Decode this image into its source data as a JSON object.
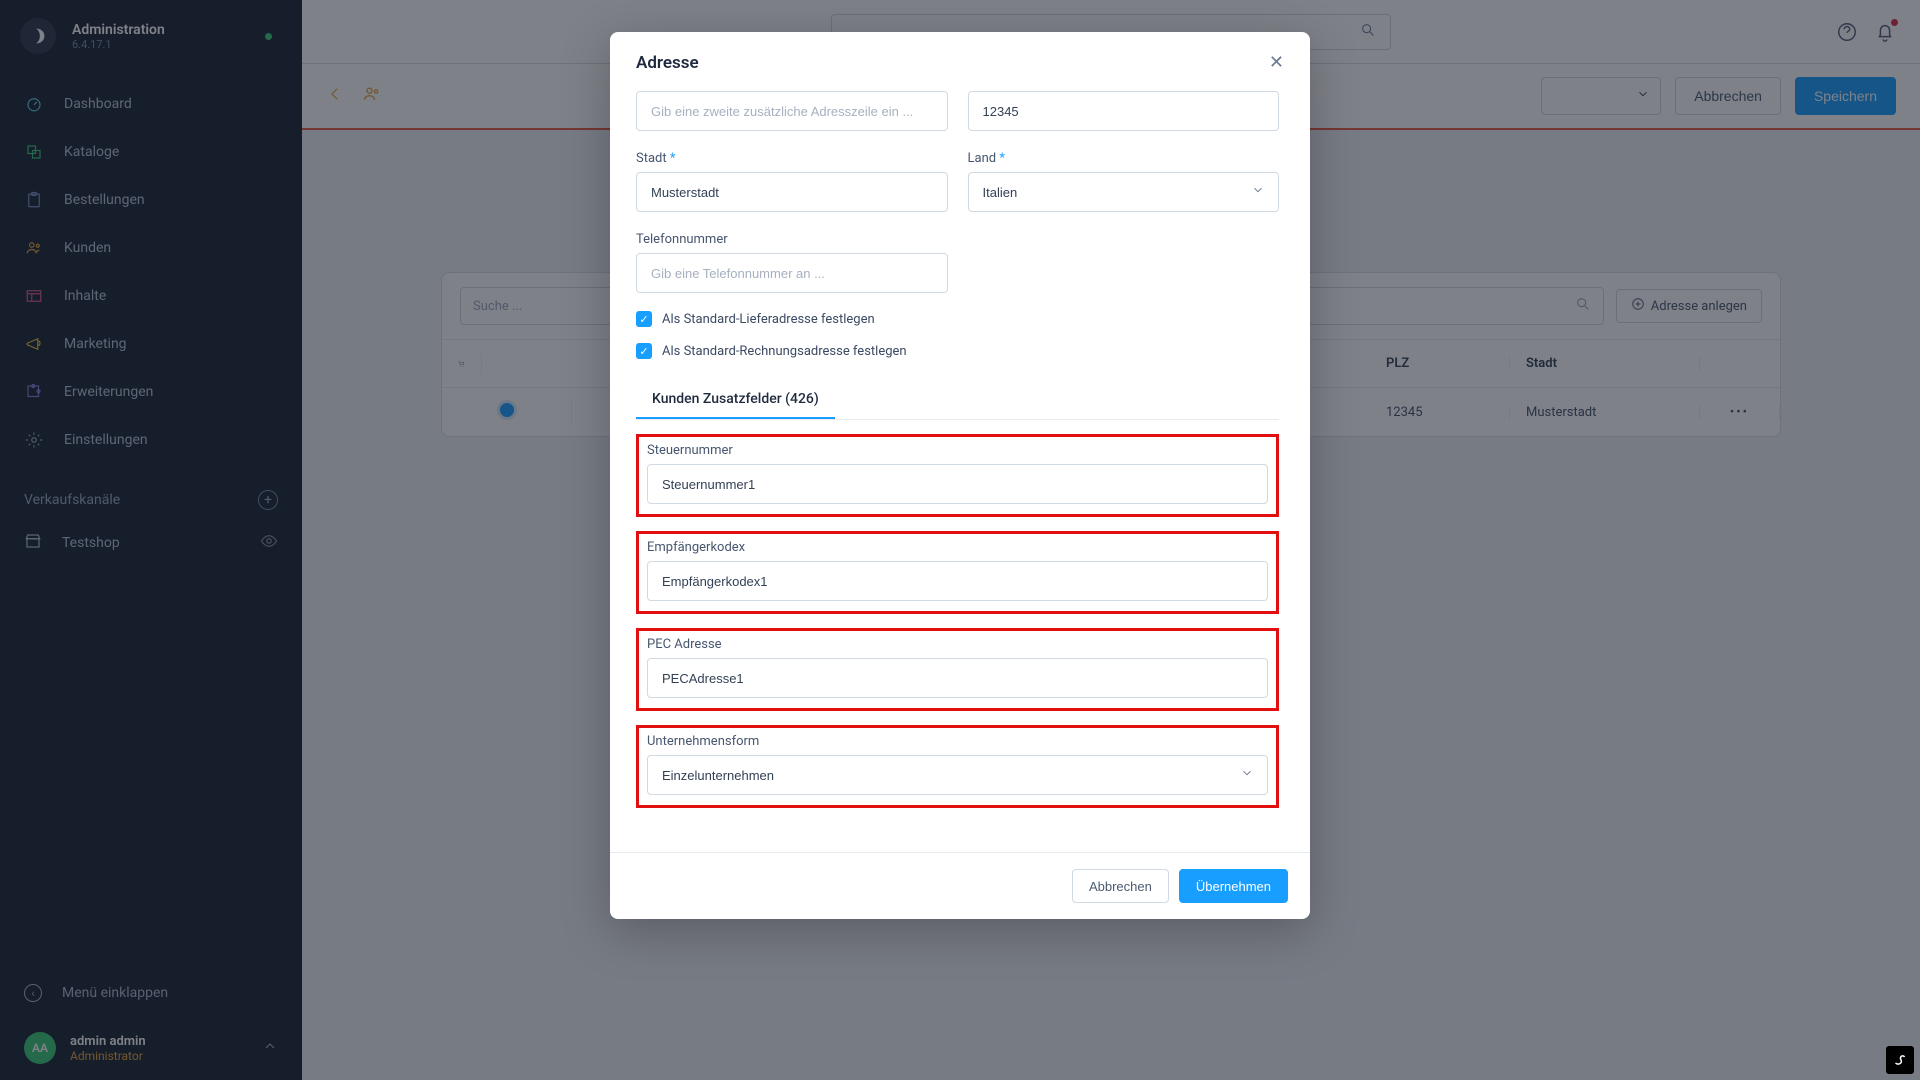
{
  "header": {
    "title": "Administration",
    "version": "6.4.17.1"
  },
  "sidebar": {
    "items": [
      {
        "label": "Dashboard"
      },
      {
        "label": "Kataloge"
      },
      {
        "label": "Bestellungen"
      },
      {
        "label": "Kunden"
      },
      {
        "label": "Inhalte"
      },
      {
        "label": "Marketing"
      },
      {
        "label": "Erweiterungen"
      },
      {
        "label": "Einstellungen"
      }
    ],
    "section_label": "Verkaufskanäle",
    "testshop": "Testshop",
    "collapse": "Menü einklappen",
    "user": {
      "initials": "AA",
      "name": "admin admin",
      "role": "Administrator"
    }
  },
  "pagebar": {
    "cancel": "Abbrechen",
    "save": "Speichern"
  },
  "card": {
    "search_placeholder": "Suche ...",
    "add_button": "Adresse anlegen",
    "columns": {
      "plz": "PLZ",
      "stadt": "Stadt"
    },
    "row": {
      "plz": "12345",
      "stadt": "Musterstadt"
    }
  },
  "modal": {
    "title": "Adresse",
    "address2_placeholder": "Gib eine zweite zusätzliche Adresszeile ein ...",
    "postal_value": "12345",
    "city_label": "Stadt",
    "city_value": "Musterstadt",
    "country_label": "Land",
    "country_value": "Italien",
    "phone_label": "Telefonnummer",
    "phone_placeholder": "Gib eine Telefonnummer an ...",
    "check1": "Als Standard-Lieferadresse festlegen",
    "check2": "Als Standard-Rechnungsadresse festlegen",
    "tab": "Kunden Zusatzfelder (426)",
    "f1_label": "Steuernummer",
    "f1_value": "Steuernummer1",
    "f2_label": "Empfängerkodex",
    "f2_value": "Empfängerkodex1",
    "f3_label": "PEC Adresse",
    "f3_value": "PECAdresse1",
    "f4_label": "Unternehmensform",
    "f4_value": "Einzelunternehmen",
    "cancel": "Abbrechen",
    "apply": "Übernehmen"
  }
}
